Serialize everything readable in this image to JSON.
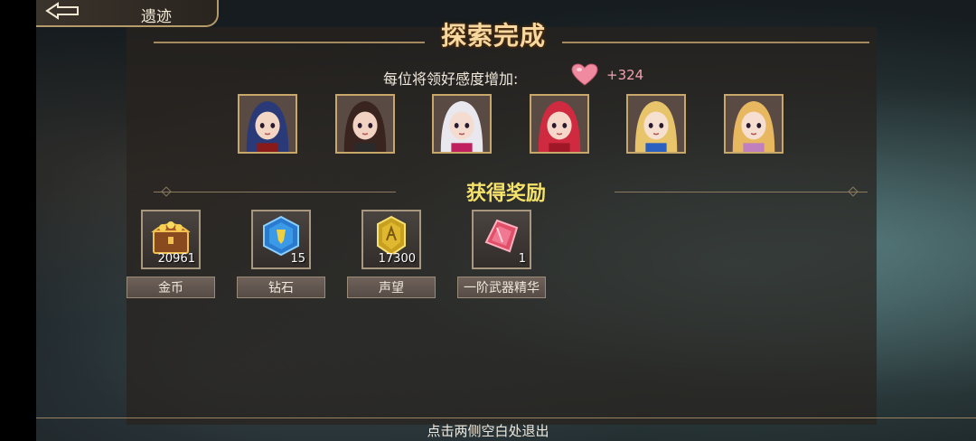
{
  "header": {
    "back_label": "遗迹",
    "title": "探索完成"
  },
  "affinity": {
    "label": "每位将领好感度增加:",
    "value": "+324",
    "icon": "heart-icon",
    "color": "#f08aa0"
  },
  "characters": [
    {
      "name": "character-portrait-1",
      "hair": "#2a3a78",
      "skin": "#f3d6c4",
      "accent": "#8a1a1a"
    },
    {
      "name": "character-portrait-2",
      "hair": "#3a2420",
      "skin": "#f2d2c2",
      "accent": "#2a2a2a"
    },
    {
      "name": "character-portrait-3",
      "hair": "#e8e8ee",
      "skin": "#f4dcd0",
      "accent": "#c02060"
    },
    {
      "name": "character-portrait-4",
      "hair": "#d02a40",
      "skin": "#f6d8ca",
      "accent": "#a01828"
    },
    {
      "name": "character-portrait-5",
      "hair": "#e8c46a",
      "skin": "#f6e0d0",
      "accent": "#2a60c0"
    },
    {
      "name": "character-portrait-6",
      "hair": "#e8b860",
      "skin": "#f6ded0",
      "accent": "#c080c0"
    }
  ],
  "rewards": {
    "title": "获得奖励",
    "items": [
      {
        "label": "金币",
        "count": "20961",
        "icon": "treasure-chest-icon"
      },
      {
        "label": "钻石",
        "count": "15",
        "icon": "diamond-crystal-icon"
      },
      {
        "label": "声望",
        "count": "17300",
        "icon": "reputation-medal-icon"
      },
      {
        "label": "一阶武器精华",
        "count": "1",
        "icon": "weapon-essence-crystal-icon"
      }
    ]
  },
  "footer": {
    "hint": "点击两侧空白处退出"
  }
}
